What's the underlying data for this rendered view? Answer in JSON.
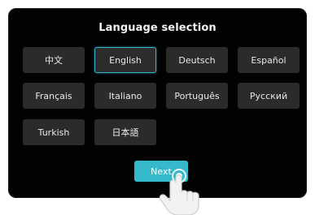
{
  "title": "Language selection",
  "languages": [
    {
      "label": "中文",
      "selected": false
    },
    {
      "label": "English",
      "selected": true
    },
    {
      "label": "Deutsch",
      "selected": false
    },
    {
      "label": "Español",
      "selected": false
    },
    {
      "label": "Français",
      "selected": false
    },
    {
      "label": "Italiano",
      "selected": false
    },
    {
      "label": "Português",
      "selected": false
    },
    {
      "label": "Русский",
      "selected": false
    },
    {
      "label": "Turkish",
      "selected": false
    },
    {
      "label": "日本語",
      "selected": false
    }
  ],
  "next_label": "Next",
  "icons": {
    "pointer": "hand-pointer-icon"
  },
  "colors": {
    "accent": "#35b8ca",
    "screen_bg": "#020203",
    "button_bg": "#2b2b2c"
  }
}
